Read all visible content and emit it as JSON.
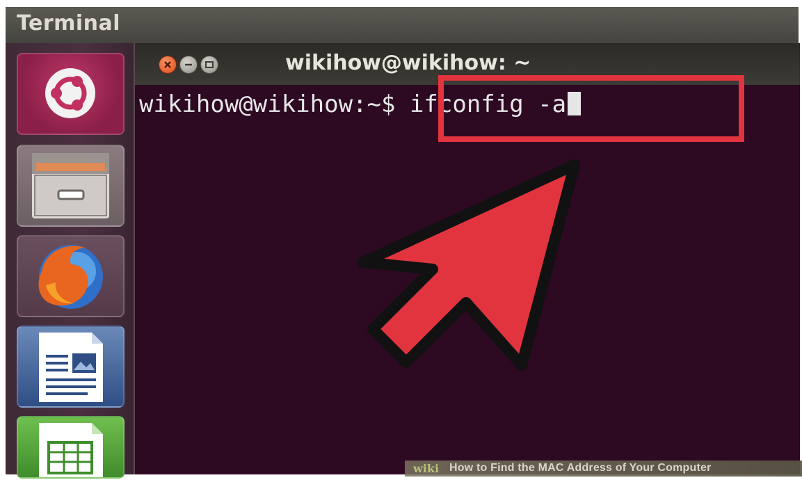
{
  "top_panel": {
    "title": "Terminal"
  },
  "launcher": {
    "items": [
      {
        "icon": "ubuntu-logo-icon"
      },
      {
        "icon": "file-cabinet-icon"
      },
      {
        "icon": "firefox-icon"
      },
      {
        "icon": "libreoffice-writer-icon"
      },
      {
        "icon": "libreoffice-calc-icon"
      }
    ]
  },
  "terminal": {
    "window_title": "wikihow@wikihow: ~",
    "prompt": "wikihow@wikihow:~$ ",
    "command": "ifconfig -a",
    "background_color": "#2d0922"
  },
  "annotations": {
    "highlight_color": "#e2343f",
    "arrow_color": "#e2343f"
  },
  "watermark": {
    "brand": "wiki",
    "text": "How to Find the MAC Address of Your Computer"
  }
}
